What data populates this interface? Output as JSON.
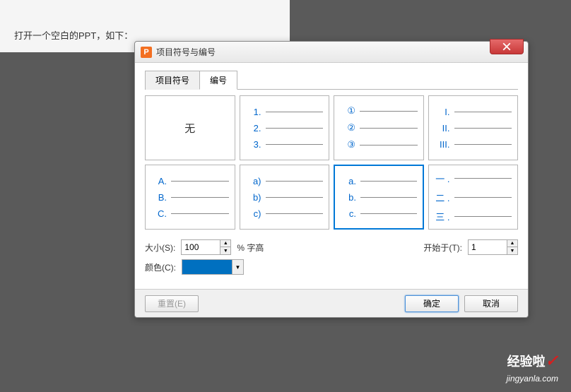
{
  "page": {
    "text": "打开一个空白的PPT，如下："
  },
  "dialog": {
    "title": "项目符号与编号",
    "tabs": {
      "bullets": "项目符号",
      "numbering": "编号"
    },
    "cells": {
      "none": "无",
      "c1": [
        "1.",
        "2.",
        "3."
      ],
      "c2": [
        "①",
        "②",
        "③"
      ],
      "c3": [
        "I.",
        "II.",
        "III."
      ],
      "c4": [
        "A.",
        "B.",
        "C."
      ],
      "c5": [
        "a)",
        "b)",
        "c)"
      ],
      "c6": [
        "a.",
        "b.",
        "c."
      ],
      "c7": [
        "一 .",
        "二 .",
        "三 ."
      ]
    },
    "controls": {
      "size_label": "大小(S):",
      "size_value": "100",
      "size_unit": "% 字高",
      "startat_label": "开始于(T):",
      "startat_value": "1",
      "color_label": "颜色(C):",
      "color_value": "#0070c0"
    },
    "footer": {
      "reset": "重置(E)",
      "ok": "确定",
      "cancel": "取消"
    }
  },
  "watermark": {
    "main": "经验啦",
    "sub": "jingyanla.com"
  }
}
